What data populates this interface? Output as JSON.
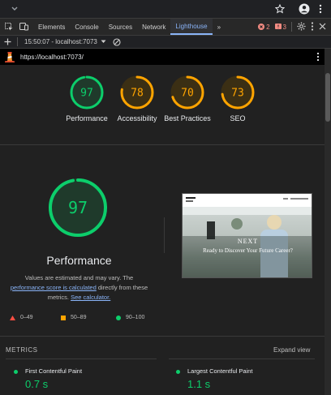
{
  "devtools": {
    "tabs": [
      "Elements",
      "Console",
      "Sources",
      "Network",
      "Lighthouse"
    ],
    "more_tabs_glyph": "»",
    "errors_count": "2",
    "warnings_count": "3"
  },
  "session": {
    "label": "15:50:07 - localhost:7073"
  },
  "url": "https://localhost:7073/",
  "scores": [
    {
      "name": "Performance",
      "score": "97",
      "color": "#0cce6b"
    },
    {
      "name": "Accessibility",
      "score": "78",
      "color": "#ffa400"
    },
    {
      "name": "Best Practices",
      "score": "70",
      "color": "#ffa400"
    },
    {
      "name": "SEO",
      "score": "73",
      "color": "#ffa400"
    }
  ],
  "performance": {
    "score": "97",
    "title": "Performance",
    "note_line1": "Values are estimated and may vary. The",
    "note_link1": "performance score is calculated",
    "note_line2_rest": " directly from these",
    "note_line3_pre": "metrics. ",
    "note_link2": "See calculator."
  },
  "legend": {
    "fail": "0–49",
    "average": "50–89",
    "pass": "90–100"
  },
  "screenshot": {
    "brand": "NEXT",
    "headline": "Ready to Discover Your Future Career?"
  },
  "metrics": {
    "section_label": "METRICS",
    "expand_label": "Expand view",
    "items": [
      {
        "name": "First Contentful Paint",
        "value": "0.7 s"
      },
      {
        "name": "Largest Contentful Paint",
        "value": "1.1 s"
      }
    ]
  }
}
